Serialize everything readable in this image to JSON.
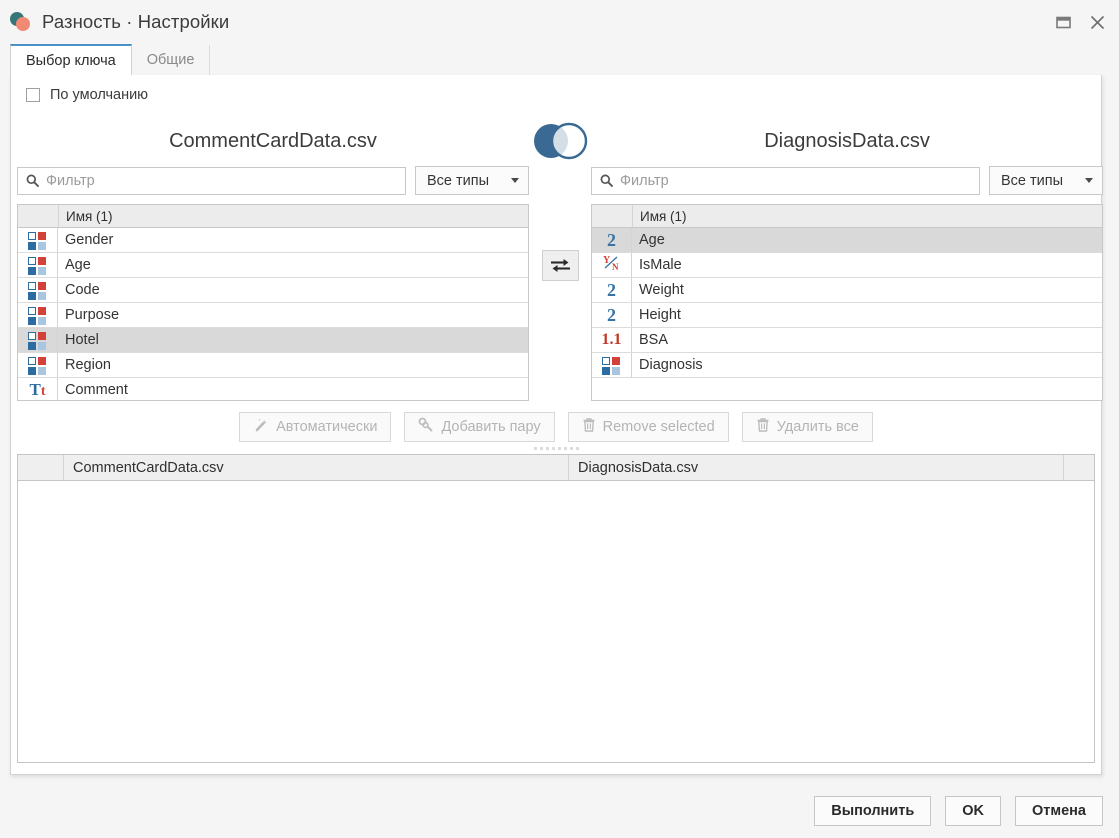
{
  "window": {
    "title": "Разность · Настройки",
    "app_icon": "venn-difference-icon",
    "restore_label": "restore-icon",
    "close_label": "close-icon"
  },
  "tabs": [
    {
      "label": "Выбор ключа",
      "active": true
    },
    {
      "label": "Общие",
      "active": false
    }
  ],
  "default_checkbox": {
    "label": "По умолчанию",
    "checked": false
  },
  "left": {
    "file_name": "CommentCardData.csv",
    "filter_placeholder": "Фильтр",
    "filter_value": "",
    "type_filter": "Все типы",
    "column_header": "Имя (1)",
    "items": [
      {
        "name": "Gender",
        "type": "nominal",
        "selected": false
      },
      {
        "name": "Age",
        "type": "nominal",
        "selected": false
      },
      {
        "name": "Code",
        "type": "nominal",
        "selected": false
      },
      {
        "name": "Purpose",
        "type": "nominal",
        "selected": false
      },
      {
        "name": "Hotel",
        "type": "nominal",
        "selected": true
      },
      {
        "name": "Region",
        "type": "nominal",
        "selected": false
      },
      {
        "name": "Comment",
        "type": "string",
        "selected": false
      }
    ]
  },
  "right": {
    "file_name": "DiagnosisData.csv",
    "filter_placeholder": "Фильтр",
    "filter_value": "",
    "type_filter": "Все типы",
    "column_header": "Имя (1)",
    "items": [
      {
        "name": "Age",
        "type": "integer",
        "selected": true
      },
      {
        "name": "IsMale",
        "type": "boolean",
        "selected": false
      },
      {
        "name": "Weight",
        "type": "integer",
        "selected": false
      },
      {
        "name": "Height",
        "type": "integer",
        "selected": false
      },
      {
        "name": "BSA",
        "type": "double",
        "selected": false
      },
      {
        "name": "Diagnosis",
        "type": "nominal",
        "selected": false
      }
    ]
  },
  "center": {
    "venn_icon": "venn-diagram-icon",
    "swap_button": "swap-columns-icon"
  },
  "actions": [
    {
      "label": "Автоматически",
      "icon": "magic-wand-icon",
      "enabled": false
    },
    {
      "label": "Добавить пару",
      "icon": "link-icon",
      "enabled": false
    },
    {
      "label": "Remove selected",
      "icon": "trash-icon",
      "enabled": false
    },
    {
      "label": "Удалить все",
      "icon": "trash-icon",
      "enabled": false
    }
  ],
  "pairs_table": {
    "col_left": "CommentCardData.csv",
    "col_right": "DiagnosisData.csv",
    "rows": []
  },
  "footer_buttons": [
    {
      "label": "Выполнить"
    },
    {
      "label": "OK"
    },
    {
      "label": "Отмена"
    }
  ],
  "colors": {
    "accent_blue": "#4a90c4",
    "venn_fill": "#3a6a93",
    "type_blue": "#2c6ca3",
    "type_red": "#d2413a",
    "type_lightblue": "#a8c6e0",
    "selection_gray": "#d9d9d9"
  }
}
